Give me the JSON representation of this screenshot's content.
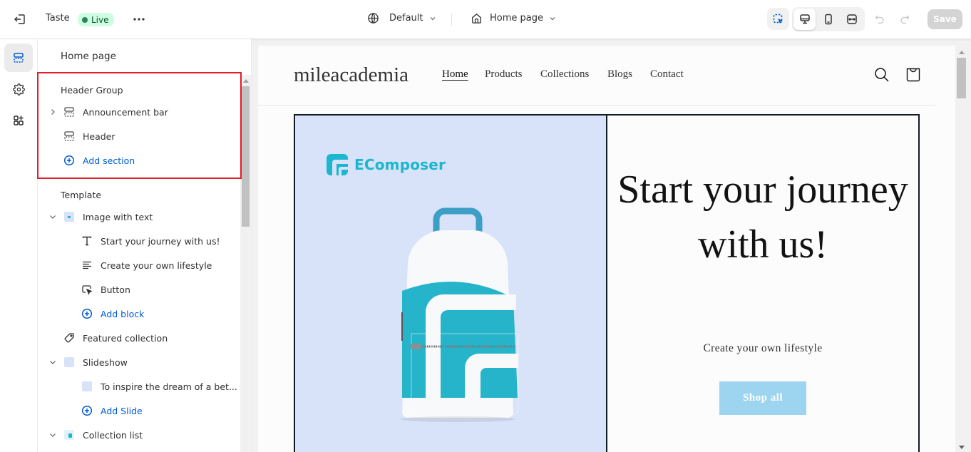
{
  "topbar": {
    "theme_name": "Taste",
    "status_badge": "Live",
    "locale_selector": "Default",
    "page_selector": "Home page",
    "save_label": "Save",
    "icons": [
      "exit-icon",
      "more-icon",
      "globe-icon",
      "home-icon",
      "inspector-icon",
      "desktop-icon",
      "mobile-icon",
      "fullscreen-icon",
      "undo-icon",
      "redo-icon"
    ]
  },
  "rail": {
    "items": [
      {
        "name": "sections",
        "icon": "sections-icon",
        "active": true
      },
      {
        "name": "theme-settings",
        "icon": "gear-icon",
        "active": false
      },
      {
        "name": "apps",
        "icon": "apps-add-icon",
        "active": false
      }
    ]
  },
  "panel": {
    "title": "Home page",
    "header_group": {
      "label": "Header Group",
      "items": [
        {
          "label": "Announcement bar",
          "icon": "section-icon",
          "expandable": true
        },
        {
          "label": "Header",
          "icon": "section-icon",
          "expandable": false
        }
      ],
      "add_label": "Add section"
    },
    "template": {
      "label": "Template",
      "sections": [
        {
          "label": "Image with text",
          "icon": "image-with-text-thumb",
          "expanded": true,
          "blocks": [
            {
              "label": "Start your journey with us!",
              "icon": "text-heading-icon"
            },
            {
              "label": "Create your own lifestyle",
              "icon": "text-paragraph-icon"
            },
            {
              "label": "Button",
              "icon": "button-cursor-icon"
            }
          ],
          "add_label": "Add block"
        },
        {
          "label": "Featured collection",
          "icon": "tag-icon",
          "expanded": false
        },
        {
          "label": "Slideshow",
          "icon": "slideshow-thumb",
          "expanded": true,
          "blocks": [
            {
              "label": "To inspire the dream of a bet...",
              "icon": "slide-thumb"
            }
          ],
          "add_label": "Add Slide"
        },
        {
          "label": "Collection list",
          "icon": "collection-list-thumb",
          "expanded": true
        }
      ]
    }
  },
  "preview": {
    "store_name": "mileacademia",
    "nav": [
      {
        "label": "Home",
        "active": true
      },
      {
        "label": "Products",
        "active": false
      },
      {
        "label": "Collections",
        "active": false
      },
      {
        "label": "Blogs",
        "active": false
      },
      {
        "label": "Contact",
        "active": false
      }
    ],
    "image_with_text": {
      "brand_name": "EComposer",
      "headline": "Start your journey with us!",
      "subtext": "Create your own lifestyle",
      "button_label": "Shop all"
    }
  },
  "colors": {
    "accent_blue": "#005bd3",
    "live_badge_bg": "#cdfee1",
    "live_dot": "#29845a",
    "highlight_border": "#e11d2a",
    "brand_teal": "#1ab7cf",
    "media_bg": "#d8e2f8",
    "shop_button": "#9dd5f0"
  }
}
